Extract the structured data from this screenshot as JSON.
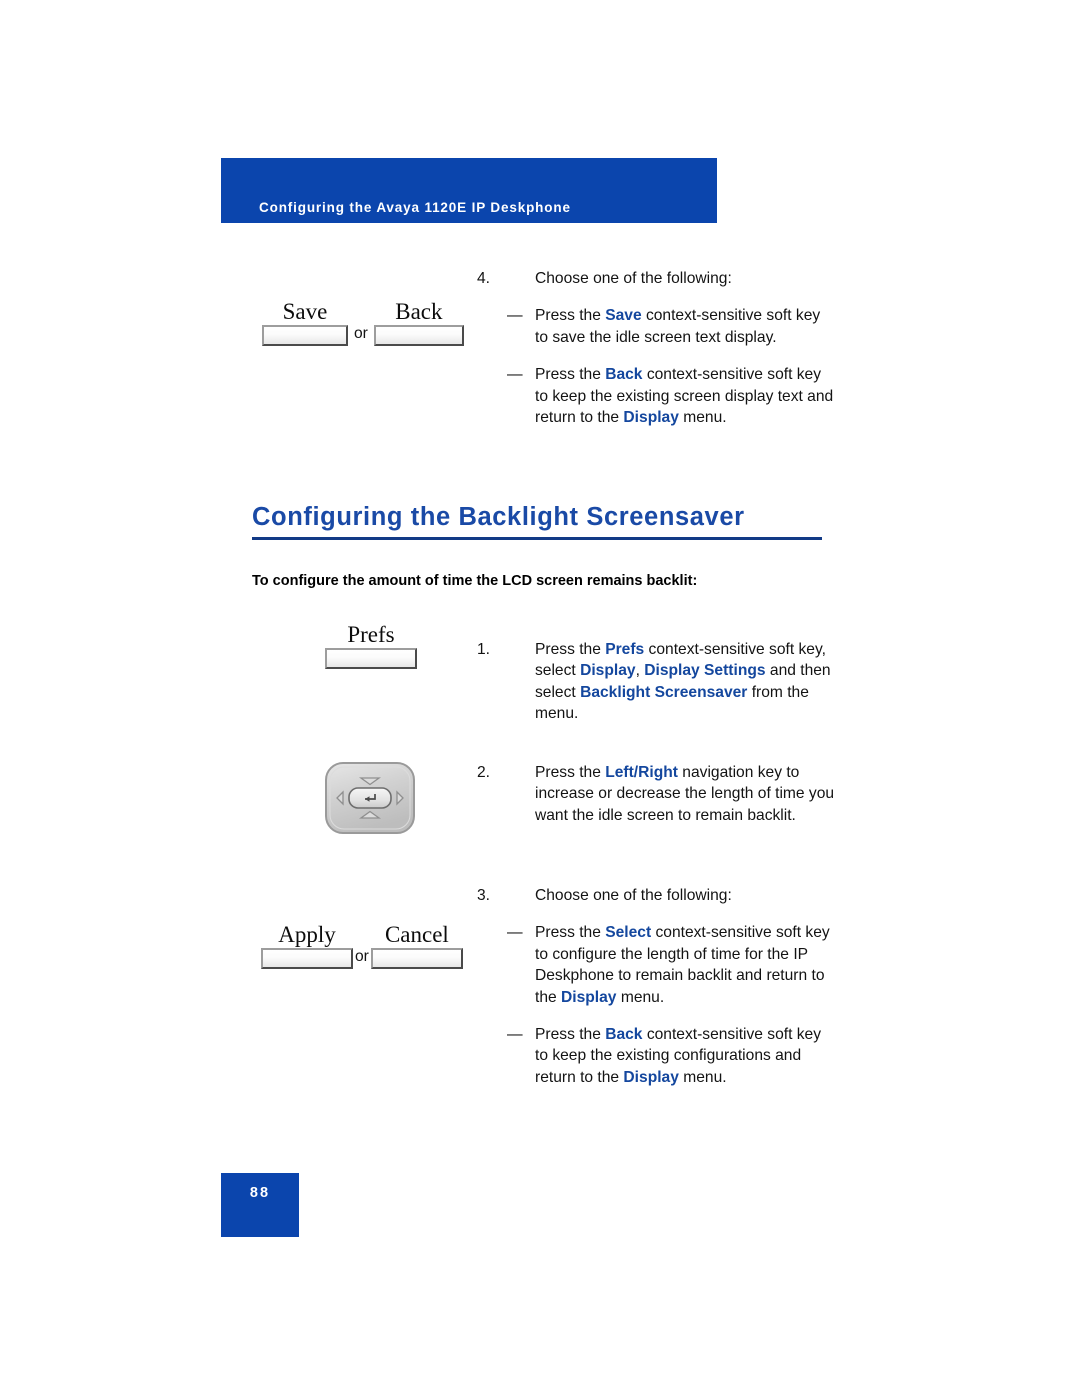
{
  "header": {
    "title": "Configuring the Avaya 1120E IP Deskphone",
    "banner_color": "#0b45ad"
  },
  "section": {
    "heading": "Configuring the Backlight Screensaver",
    "heading_color": "#1a4aa6",
    "rule_color": "#123a86",
    "subheading": "To configure the amount of time the LCD screen remains backlit:"
  },
  "inline_highlight_color": "#14479e",
  "softkeys": {
    "save": "Save",
    "back": "Back",
    "prefs": "Prefs",
    "apply": "Apply",
    "cancel": "Cancel",
    "or": "or"
  },
  "steps": {
    "step4": {
      "number": "4.",
      "text": "Choose one of the following:",
      "bullets": [
        {
          "dash": "—",
          "parts": [
            {
              "t": "Press the ",
              "b": false
            },
            {
              "t": "Save",
              "b": true
            },
            {
              "t": " context-sensitive soft key to save the idle screen text display.",
              "b": false
            }
          ]
        },
        {
          "dash": "—",
          "parts": [
            {
              "t": "Press the ",
              "b": false
            },
            {
              "t": "Back",
              "b": true
            },
            {
              "t": " context-sensitive soft key to keep the existing screen display text and return to the ",
              "b": false
            },
            {
              "t": "Display",
              "b": true
            },
            {
              "t": " menu.",
              "b": false
            }
          ]
        }
      ]
    },
    "step1": {
      "number": "1.",
      "parts": [
        {
          "t": "Press the ",
          "b": false
        },
        {
          "t": "Prefs",
          "b": true
        },
        {
          "t": " context-sensitive soft key, select ",
          "b": false
        },
        {
          "t": "Display",
          "b": true
        },
        {
          "t": ", ",
          "b": false
        },
        {
          "t": "Display Settings",
          "b": true
        },
        {
          "t": " and then select ",
          "b": false
        },
        {
          "t": "Backlight Screensaver",
          "b": true
        },
        {
          "t": " from the menu.",
          "b": false
        }
      ]
    },
    "step2": {
      "number": "2.",
      "parts": [
        {
          "t": "Press the ",
          "b": false
        },
        {
          "t": "Left/Right",
          "b": true
        },
        {
          "t": " navigation key to increase or decrease the length of time you want the idle screen to remain backlit.",
          "b": false
        }
      ]
    },
    "step3": {
      "number": "3.",
      "text": "Choose one of the following:",
      "bullets": [
        {
          "dash": "—",
          "parts": [
            {
              "t": "Press the ",
              "b": false
            },
            {
              "t": "Select",
              "b": true
            },
            {
              "t": " context-sensitive soft key to configure the length of time for the IP Deskphone to remain backlit and return to the ",
              "b": false
            },
            {
              "t": "Display",
              "b": true
            },
            {
              "t": " menu.",
              "b": false
            }
          ]
        },
        {
          "dash": "—",
          "parts": [
            {
              "t": "Press the ",
              "b": false
            },
            {
              "t": "Back",
              "b": true
            },
            {
              "t": " context-sensitive soft key to keep the existing configurations and return to the ",
              "b": false
            },
            {
              "t": "Display",
              "b": true
            },
            {
              "t": " menu.",
              "b": false
            }
          ]
        }
      ]
    }
  },
  "footer": {
    "page_number": "88",
    "box_color": "#0b45ad"
  }
}
